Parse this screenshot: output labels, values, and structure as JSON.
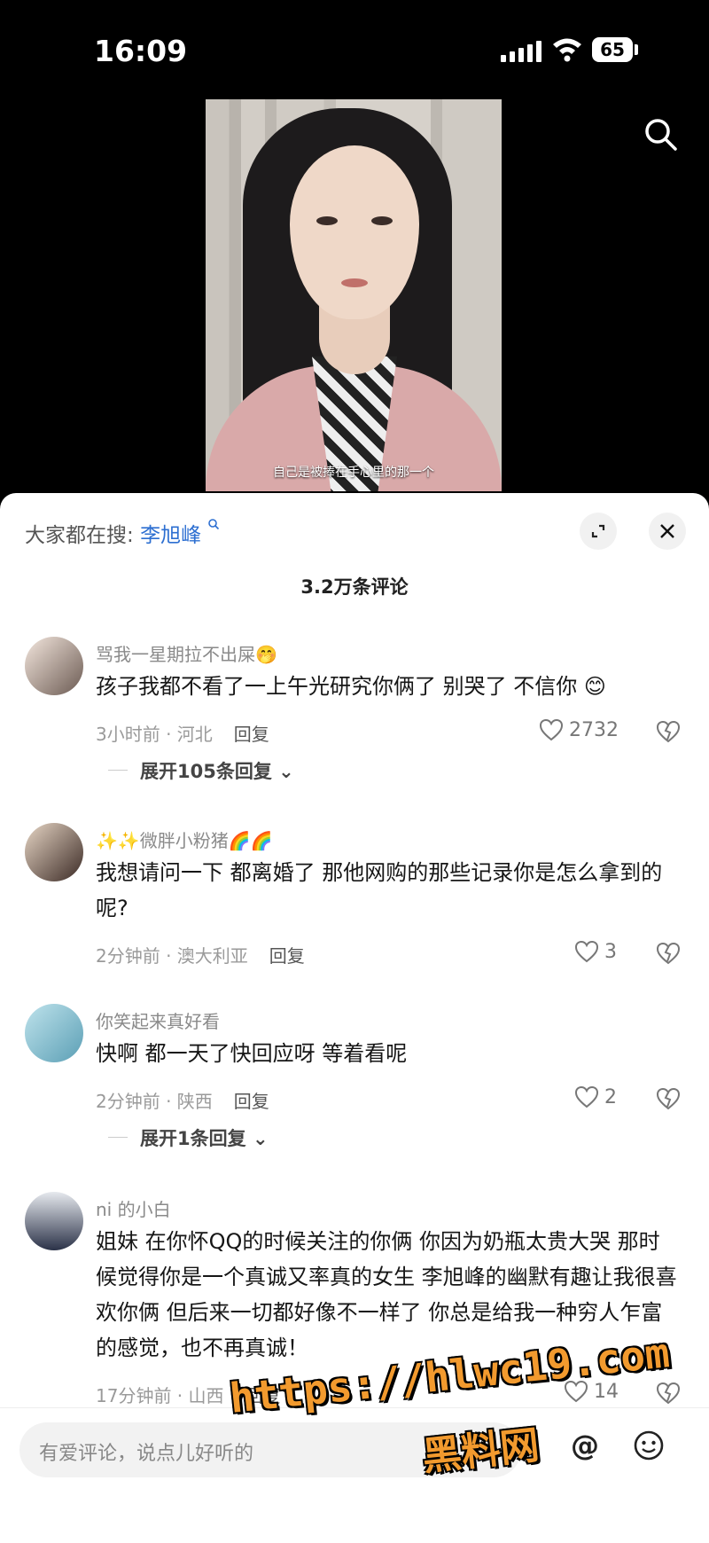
{
  "status_bar": {
    "time": "16:09",
    "battery": "65"
  },
  "video": {
    "subtitle": "自己是被捧在手心里的那一个"
  },
  "panel": {
    "hot_prefix": "大家都在搜:",
    "hot_keyword": "李旭峰",
    "comment_count": "3.2万条评论"
  },
  "comments": [
    {
      "user": "骂我一星期拉不出屎🤭",
      "text": "孩子我都不看了一上午光研究你俩了 别哭了 不信你 😊",
      "time_loc": "3小时前 · 河北",
      "reply": "回复",
      "likes": "2732",
      "more": "展开105条回复"
    },
    {
      "user": "✨✨微胖小粉猪🌈🌈",
      "text": "我想请问一下 都离婚了 那他网购的那些记录你是怎么拿到的呢?",
      "time_loc": "2分钟前 · 澳大利亚",
      "reply": "回复",
      "likes": "3"
    },
    {
      "user": "你笑起来真好看",
      "text": "快啊 都一天了快回应呀 等着看呢",
      "time_loc": "2分钟前 · 陕西",
      "reply": "回复",
      "likes": "2",
      "more": "展开1条回复"
    },
    {
      "user": "ni 的小白",
      "text": "姐妹 在你怀QQ的时候关注的你俩 你因为奶瓶太贵大哭 那时候觉得你是一个真诚又率真的女生 李旭峰的幽默有趣让我很喜欢你俩 但后来一切都好像不一样了 你总是给我一种穷人乍富的感觉，也不再真诚！",
      "time_loc": "17分钟前 · 山西",
      "reply": "回复",
      "likes": "14"
    }
  ],
  "input": {
    "placeholder": "有爱评论，说点儿好听的"
  },
  "watermark": {
    "url": "https://hlwc19.com",
    "name": "黑料网"
  },
  "colors": {
    "accent": "#2d6fd1",
    "watermark": "#f29a2e"
  }
}
